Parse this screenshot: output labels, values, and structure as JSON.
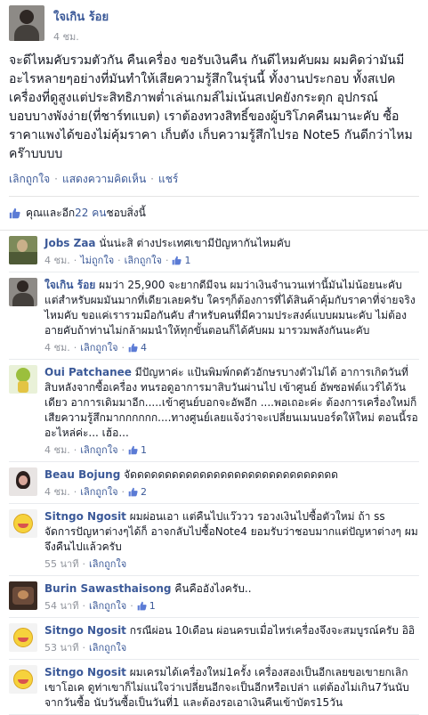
{
  "post": {
    "author": "ใจเกิน ร้อย",
    "time": "4 ชม.",
    "body": "จะดีไหมคับรวมตัวกัน คืนเครื่อง ขอรับเงินคืน กันดีไหมคับผม ผมคิดว่ามันมีอะไรหลายๆอย่างที่มันทำให้เสียความรู้สึกในรุ่นนี้ ทั้งงานประกอบ ทั้งสเปคเครื่องที่ดูสูงแต่ประสิทธิภาพต่ำเล่นเกมส์ไม่เน้นสเปคยังกระตุก อุปกรณ์บอบบางพังง่าย(ที่ชาร์ทแบต) เราต้องทวงสิทธิ์ของผู้บริโภคคืนมานะคับ ซื้อราคาแพงได้ของไม่คุ้มราคา เก็บตัง เก็บความรู้สึกไปรอ Note5 กันดีกว่าไหมคร๊าบบบบ",
    "actions": {
      "like": "เลิกถูกใจ",
      "comment": "แสดงความคิดเห็น",
      "share": "แชร์"
    }
  },
  "likes": {
    "prefix": "คุณและอีก ",
    "count_text": "22 คน",
    "suffix": "ชอบสิ่งนี้"
  },
  "comments": [
    {
      "name": "Jobs Zaa",
      "text": "นั่นน่ะสิ ต่างประเทศเขามีปัญหากันไหมคับ",
      "time": "4 ชม.",
      "actions": [
        "ไม่ถูกใจ",
        "เลิกถูกใจ"
      ],
      "likes": "1",
      "avatar": "jobs"
    },
    {
      "name": "ใจเกิน ร้อย",
      "text": "ผมว่า 25,900 จะยากดีมีจน ผมว่าเงินจำนวนเท่านี้มันไม่น้อยนะคับ แต่สำหรับผมมันมากที่เดียวเลยครับ ใครๆก็ต้องการที่ได้สินค้าคุ้มกับราคาที่จ่ายจริงไหมคับ ขอแค่เรารวมมือกันคับ สำหรับคนที่มีความประสงค์แบบผมนะคับ ไม่ต้องอายคับถ้าท่านไม่กล้าผมนำให้ทุกขั้นตอนก็ได้คับผม มารวมพลังกันนะคับ",
      "time": "4 ชม.",
      "actions": [
        "เลิกถูกใจ"
      ],
      "likes": "4",
      "avatar": "chai"
    },
    {
      "name": "Oui Patchanee",
      "text": "มีปัญหาค่ะ แป้นพิมพ์กดตัวอักษรบางตัวไม่ได้ อาการเกิดวันที่สิบหลังจากซื้อเครื่อง ทนรอดูอาการมาสิบวันผ่านไป เข้าศูนย์ อัพซอฟต์แวร์ได้วันเดียว อาการเดิมมาอีก.....เข้าศูนย์บอกจะอัพอีก ....พอเถอะค่ะ ต้องการเครื่องใหม่ก็ เสียความรู้สึกมากกกกกก....ทางศูนย์เลยแจ้งว่าจะเปลี่ยนเมนบอร์ดให้ใหม่ ตอนนี้รออะไหล่ค่ะ... เฮ้อ...",
      "time": "4 ชม.",
      "actions": [
        "เลิกถูกใจ"
      ],
      "likes": "1",
      "avatar": "oui"
    },
    {
      "name": "Beau Bojung",
      "text": "จัดดดดดดดดดดดดดดดดดดดดดดดดดดดดดด",
      "time": "4 ชม.",
      "actions": [
        "เลิกถูกใจ"
      ],
      "likes": "2",
      "avatar": "beau"
    },
    {
      "name": "Sitngo Ngosit",
      "text": "ผมผ่อนเอา แต่คืนไปแว๊ววว รอวงเงินไปซื้อตัวใหม่ ถ้า ss จัดการปัญหาต่างๆได้ก็ อาจกลับไปซื้อNote4 ยอมรับว่าชอบมากแต่ปัญหาต่างๆ ผมจึงคืนไปแล้วครับ",
      "time": "55 นาที",
      "actions": [
        "เลิกถูกใจ"
      ],
      "likes": "",
      "avatar": "sit"
    },
    {
      "name": "Burin Sawasthaisong",
      "text": "คืนคืออังไงครับ..",
      "time": "54 นาที",
      "actions": [
        "เลิกถูกใจ"
      ],
      "likes": "1",
      "avatar": "burin"
    },
    {
      "name": "Sitngo Ngosit",
      "text": "กรณีผ่อน 10เดือน ผ่อนครบเมื่อไหร่เครื่องจึงจะสมบูรณ์ครับ อิอิ",
      "time": "53 นาที",
      "actions": [
        "เลิกถูกใจ"
      ],
      "likes": "",
      "avatar": "sit"
    },
    {
      "name": "Sitngo Ngosit",
      "text": "ผมเครมได้เครื่องใหม่1ครั้ง เครื่องสองเป็นอีกเลยขอเขายกเลิกเขาโอเค ดูท่าเขาก็ไม่แน่ใจว่าเปลี่ยนอีกจะเป็นอีกหรือเปล่า แต่ต้องไม่เกิน7วันนับจากวันซื้อ นับวันซื้อเป็นวันที่1 และต้องรอเอาเงินคืนเข้าบัตร15วัน",
      "time": "",
      "actions": [],
      "likes": "",
      "avatar": "sit"
    }
  ],
  "colors": {
    "link": "#3b5998",
    "meta": "#90949c",
    "text": "#141823"
  }
}
